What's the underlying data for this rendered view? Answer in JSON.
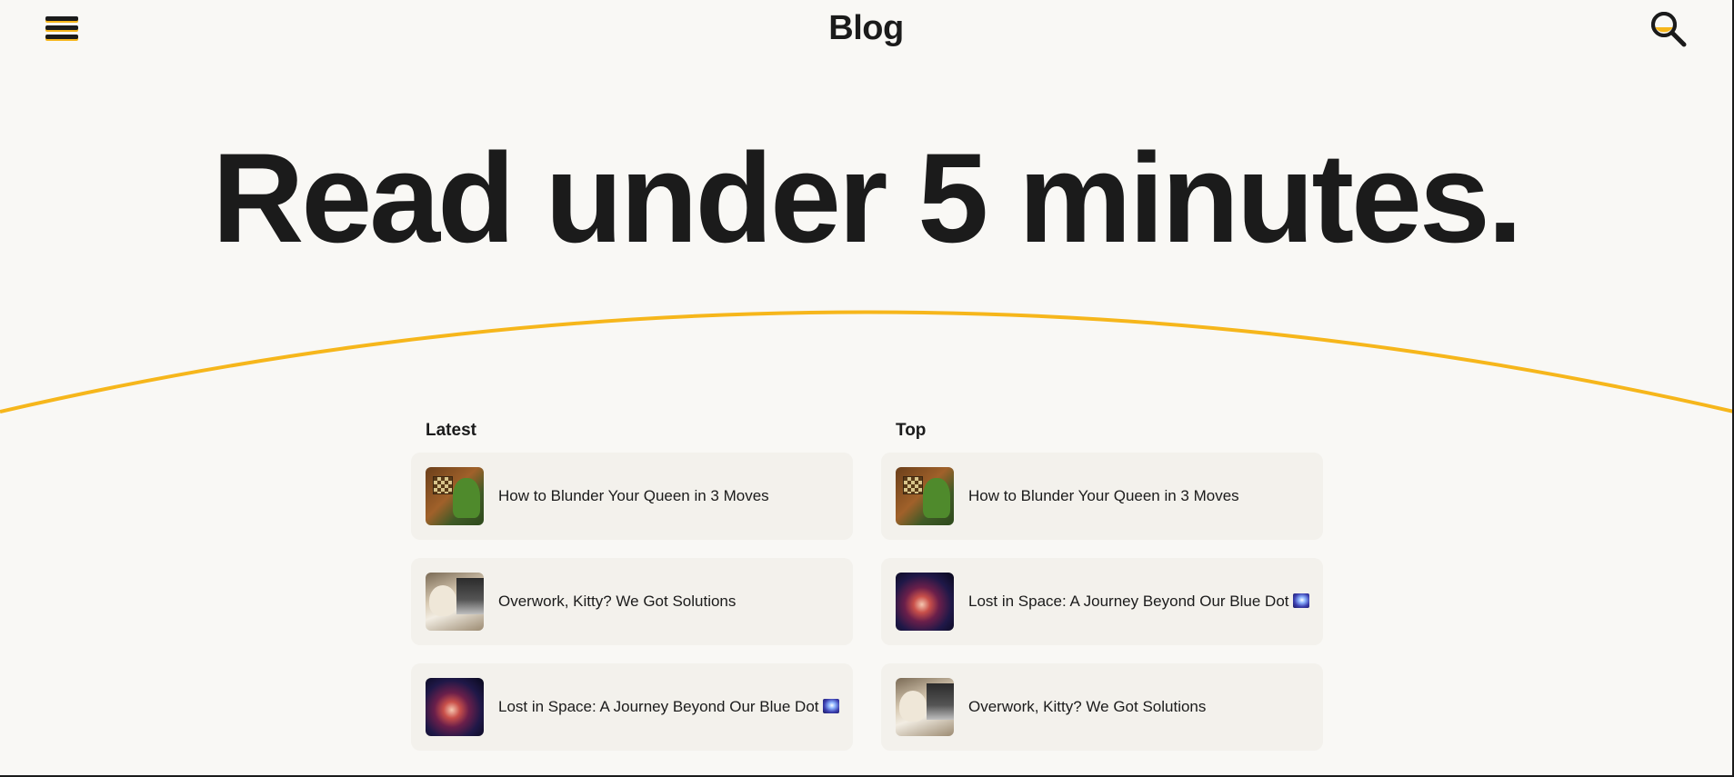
{
  "header": {
    "title": "Blog",
    "menu_icon": "hamburger-menu-icon",
    "search_icon": "search-icon"
  },
  "hero": {
    "headline": "Read under 5 minutes."
  },
  "colors": {
    "accent": "#f6b61b",
    "text": "#1b1b1b",
    "background": "#f9f8f5",
    "card": "#f3f1ec"
  },
  "latest": {
    "heading": "Latest",
    "items": [
      {
        "title": "How to Blunder Your Queen in 3 Moves",
        "thumbnail": "pepe-chess"
      },
      {
        "title": "Overwork, Kitty? We Got Solutions",
        "thumbnail": "cat-laptop"
      },
      {
        "title": "Lost in Space: A Journey Beyond Our Blue Dot",
        "thumbnail": "galaxy",
        "emoji": "milky-way"
      }
    ]
  },
  "top": {
    "heading": "Top",
    "items": [
      {
        "title": "How to Blunder Your Queen in 3 Moves",
        "thumbnail": "pepe-chess"
      },
      {
        "title": "Lost in Space: A Journey Beyond Our Blue Dot",
        "thumbnail": "galaxy",
        "emoji": "milky-way"
      },
      {
        "title": "Overwork, Kitty? We Got Solutions",
        "thumbnail": "cat-laptop"
      }
    ]
  }
}
